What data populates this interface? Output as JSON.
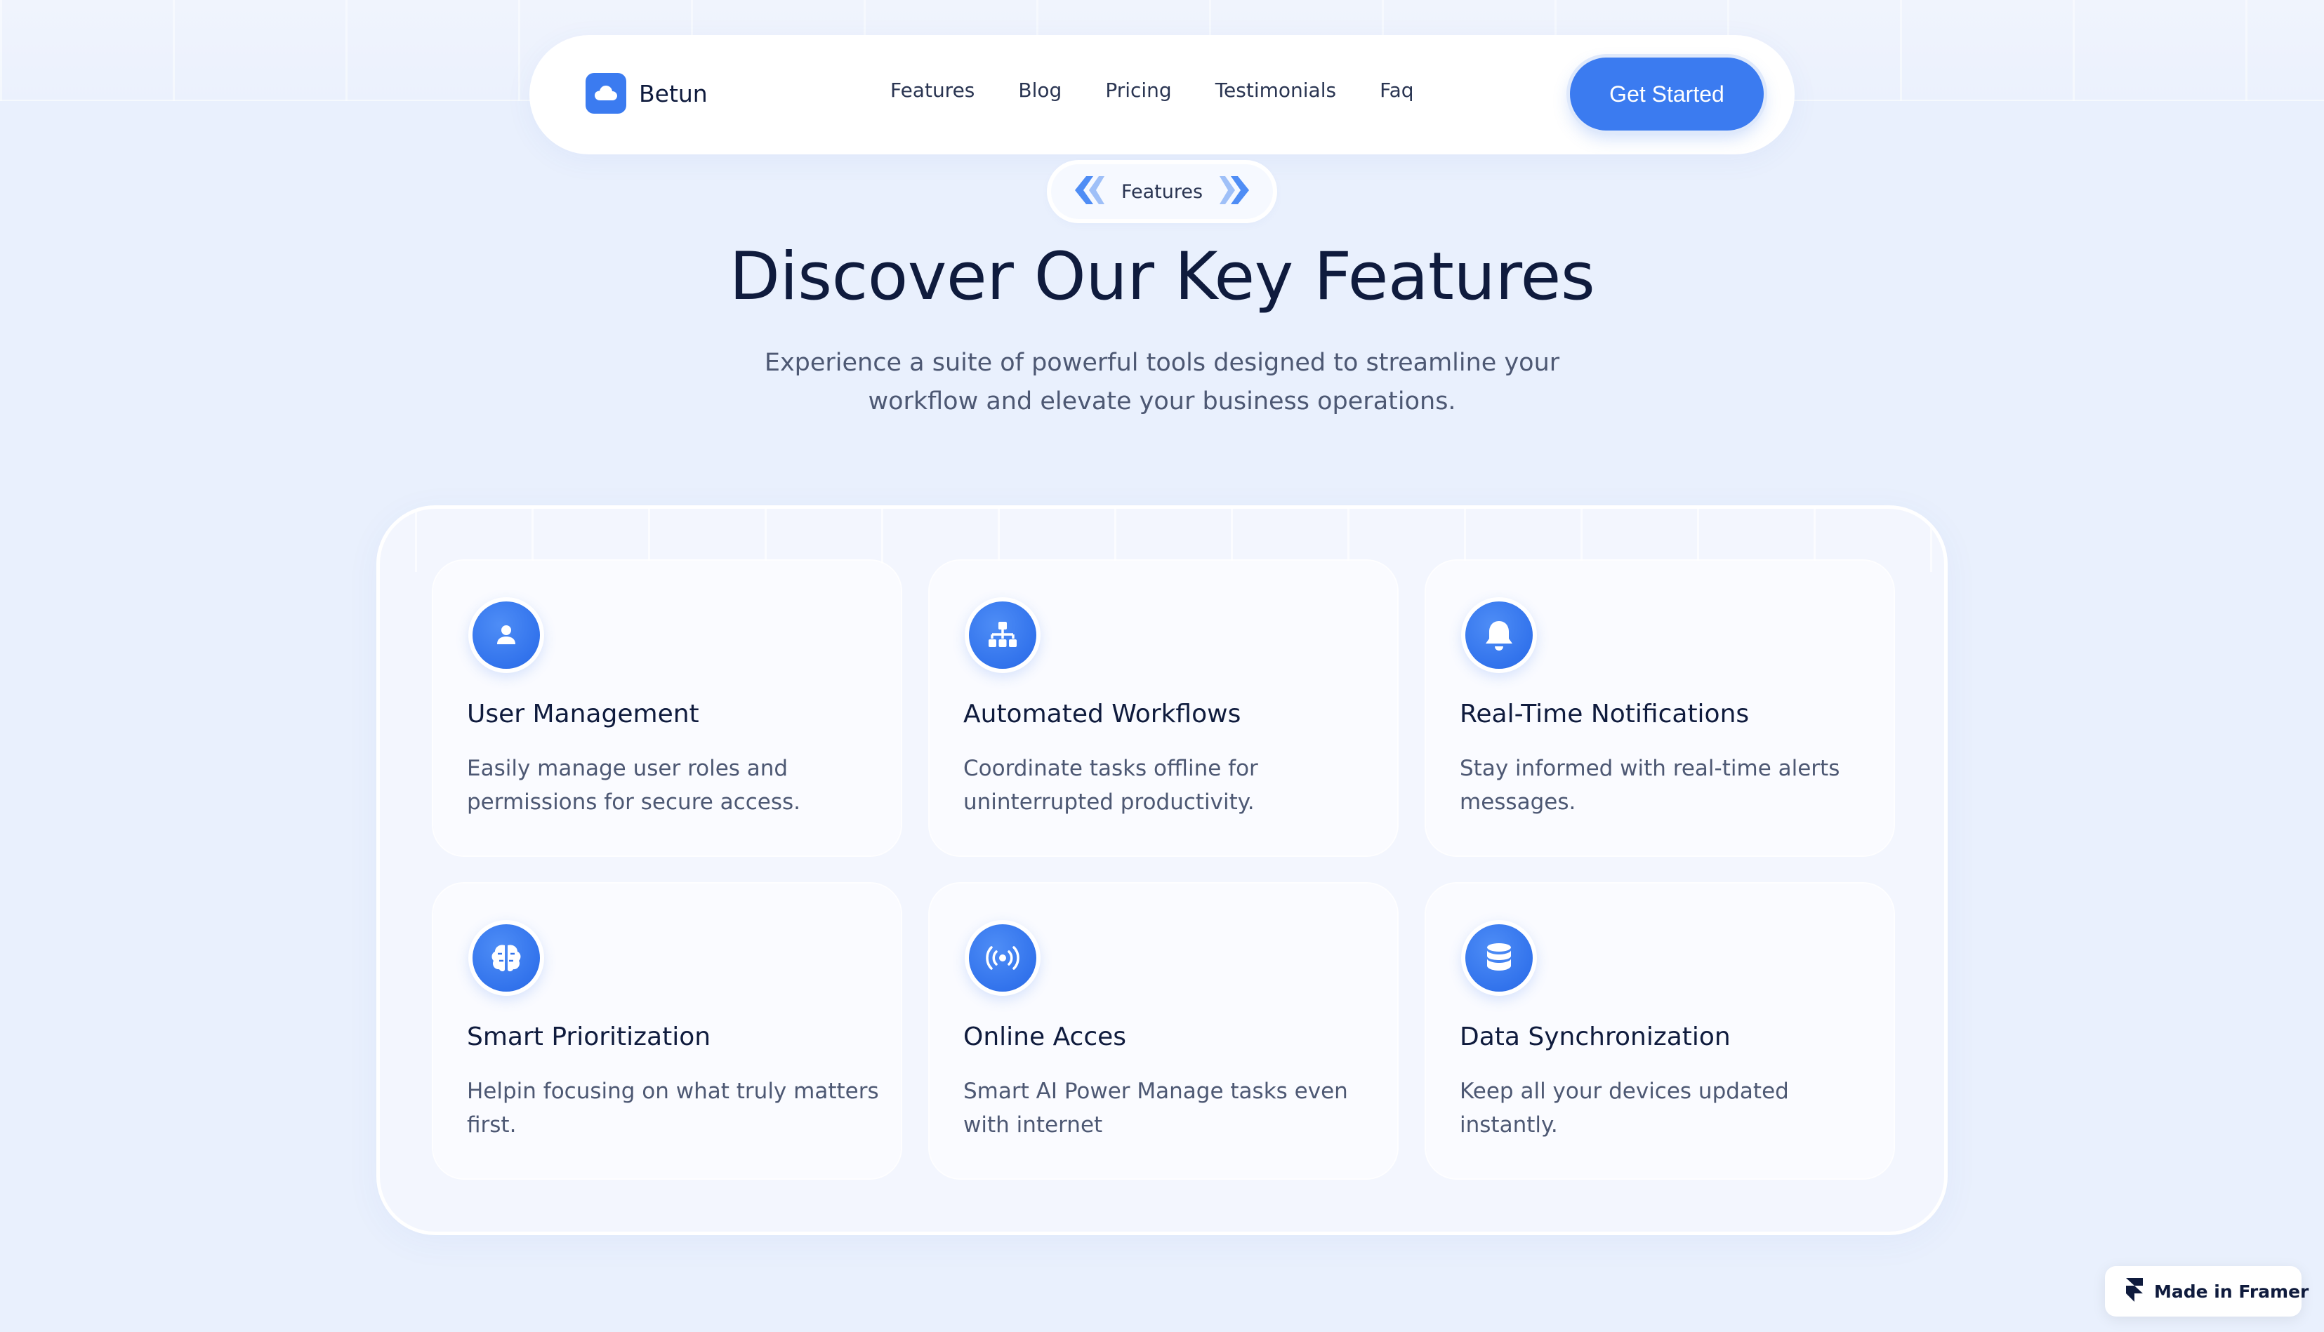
{
  "brand": {
    "name": "Betun",
    "icon": "cloud-icon"
  },
  "nav": {
    "links": [
      "Features",
      "Blog",
      "Pricing",
      "Testimonials",
      "Faq"
    ],
    "cta_label": "Get Started"
  },
  "hero": {
    "pill_label": "Features",
    "headline": "Discover Our Key Features",
    "subtext": "Experience a suite of powerful tools designed to streamline your workflow and elevate your business operations."
  },
  "features": [
    {
      "icon": "user-icon",
      "title": "User Management",
      "desc": "Easily manage user roles and permissions for secure access."
    },
    {
      "icon": "hierarchy-icon",
      "title": "Automated Workflows",
      "desc": "Coordinate tasks offline for uninterrupted productivity."
    },
    {
      "icon": "bell-icon",
      "title": "Real-Time Notifications",
      "desc": "Stay informed with real-time alerts messages."
    },
    {
      "icon": "brain-icon",
      "title": "Smart Prioritization",
      "desc": "Helpin  focusing on what truly matters first."
    },
    {
      "icon": "broadcast-icon",
      "title": "Online Acces",
      "desc": "Smart AI Power Manage tasks even with internet"
    },
    {
      "icon": "database-icon",
      "title": "Data Synchronization",
      "desc": "Keep all your devices updated instantly."
    }
  ],
  "badge": {
    "label": "Made in Framer",
    "icon": "framer-icon"
  },
  "colors": {
    "accent": "#3b7bf0",
    "background": "#e9f0fd",
    "text": "#0f1b3d",
    "muted": "#4d5873"
  }
}
